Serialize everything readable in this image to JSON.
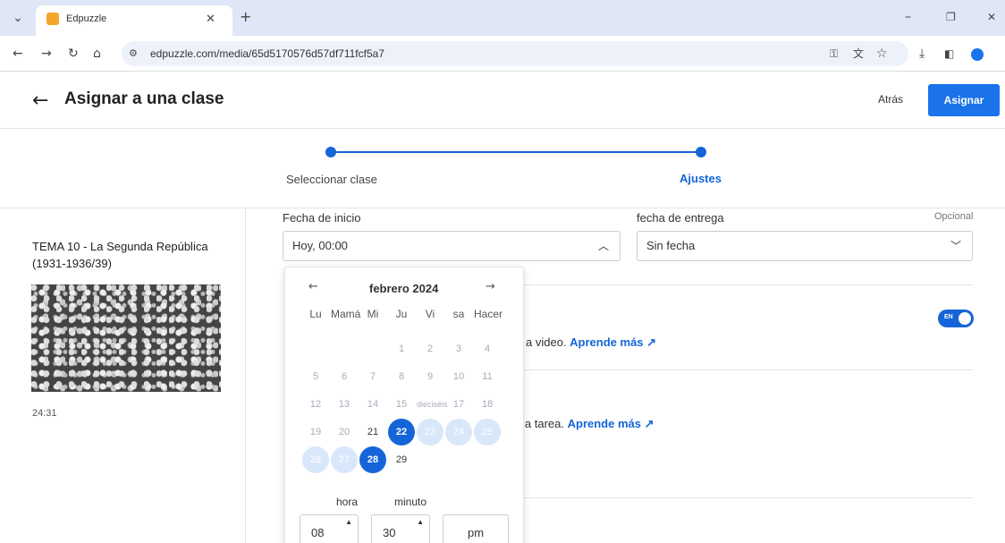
{
  "browser": {
    "tab_title": "Edpuzzle",
    "url": "edpuzzle.com/media/65d5170576d57df711fcf5a7"
  },
  "header": {
    "title": "Asignar a una clase",
    "back_label": "Atrás",
    "assign_label": "Asignar"
  },
  "steps": [
    {
      "label": "Seleccionar clase"
    },
    {
      "label": "Ajustes"
    }
  ],
  "media": {
    "title": "TEMA 10 - La Segunda República (1931-1936/39)",
    "duration": "24:31"
  },
  "form": {
    "start_label": "Fecha de inicio",
    "start_value": "Hoy, 00:00",
    "due_label": "fecha de entrega",
    "due_optional": "Opcional",
    "due_value": "Sin fecha"
  },
  "calendar": {
    "month": "febrero 2024",
    "weekdays": [
      "Lu",
      "Mamá",
      "Mi",
      "Ju",
      "Vi",
      "sa",
      "Hacer"
    ],
    "rows": [
      [
        "",
        "",
        "",
        "1",
        "2",
        "3",
        "4"
      ],
      [
        "5",
        "6",
        "7",
        "8",
        "9",
        "10",
        "11"
      ],
      [
        "12",
        "13",
        "14",
        "15",
        "dieciséis",
        "17",
        "18"
      ],
      [
        "19",
        "20",
        "21",
        "22",
        "23",
        "24",
        "25"
      ],
      [
        "26",
        "27",
        "28",
        "29",
        "",
        "",
        ""
      ]
    ],
    "hour_label": "hora",
    "minute_label": "minuto",
    "hour": "08",
    "minute": "30",
    "ampm": "pm"
  },
  "settings": [
    {
      "text": "a video.",
      "link": "Aprende más"
    },
    {
      "text": "la tarea.",
      "link": "Aprende más"
    }
  ],
  "toggle": {
    "label": "EN",
    "on": true
  },
  "colors": {
    "accent": "#1565d8"
  }
}
